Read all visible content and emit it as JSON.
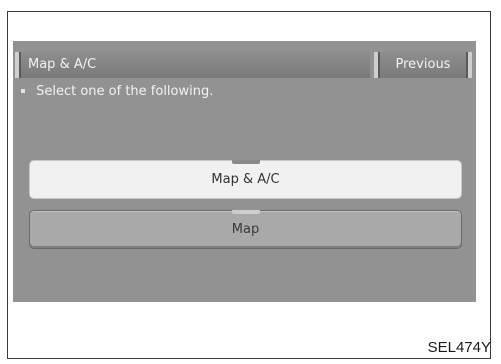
{
  "header": {
    "title": "Map & A/C",
    "previous_label": "Previous"
  },
  "instruction": {
    "bullet_icon": "square-bullet-icon",
    "text": "Select one of the following."
  },
  "options": [
    {
      "label": "Map & A/C",
      "state": "selected"
    },
    {
      "label": "Map",
      "state": "normal"
    }
  ],
  "figure_code": "SEL474Y",
  "colors": {
    "screen_background": "#929292",
    "header_background": "#858585",
    "selected_option": "#f1f1f1",
    "normal_option": "#a9a9a9",
    "header_text": "#f2f2f2"
  }
}
